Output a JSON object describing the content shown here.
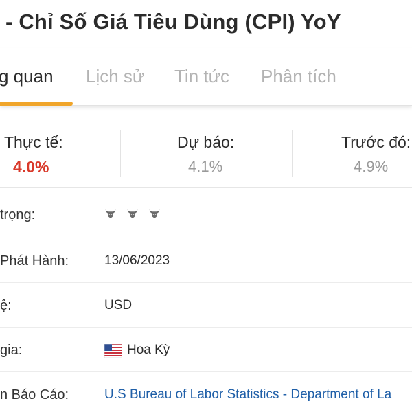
{
  "page": {
    "title": "- Chỉ Số Giá Tiêu Dùng (CPI) YoY"
  },
  "tabs": [
    {
      "label": "g quan",
      "active": true
    },
    {
      "label": "Lịch sử",
      "active": false
    },
    {
      "label": "Tin tức",
      "active": false
    },
    {
      "label": "Phân tích",
      "active": false
    }
  ],
  "stats": {
    "actual": {
      "label": "Thực tế:",
      "value": "4.0%"
    },
    "forecast": {
      "label": "Dự báo:",
      "value": "4.1%"
    },
    "previous": {
      "label": "Trước đó:",
      "value": "4.9%"
    }
  },
  "details": {
    "importance": {
      "label": "trọng:",
      "level": 3,
      "icon": "bull-icon"
    },
    "release_date": {
      "label": "Phát Hành:",
      "value": "13/06/2023"
    },
    "currency": {
      "label": "ệ:",
      "value": "USD"
    },
    "country": {
      "label": "gia:",
      "value": "Hoa Kỳ",
      "flag": "us-flag-icon"
    },
    "source": {
      "label": "n Báo Cáo:",
      "value": "U.S Bureau of Labor Statistics - Department of La"
    }
  },
  "colors": {
    "accent": "#f0a52a",
    "actual_value": "#d93a2b",
    "link": "#1f5fa8",
    "muted": "#9a9a9a"
  }
}
